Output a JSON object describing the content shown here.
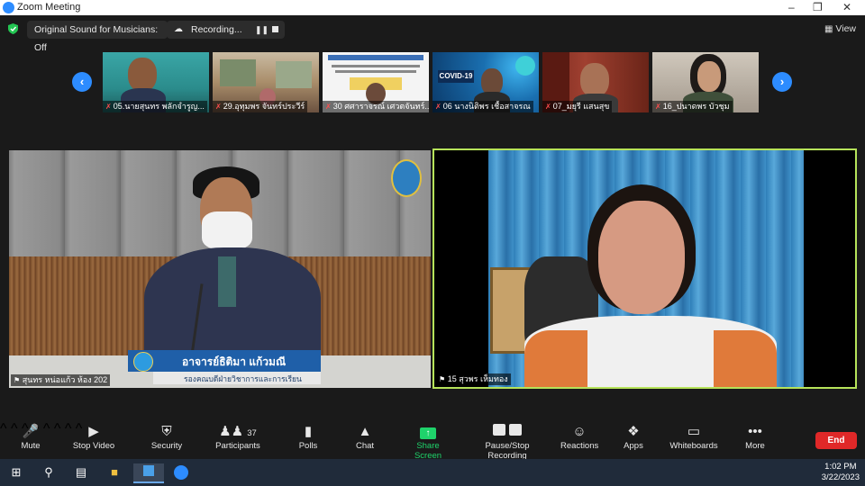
{
  "window": {
    "title": "Zoom Meeting"
  },
  "topbar": {
    "audio_label": "Original Sound for Musicians: Off",
    "recording_label": "Recording...",
    "view_label": "View"
  },
  "gallery": {
    "participants": [
      {
        "name": "05.นายสุนทร พลักจำรูญ..."
      },
      {
        "name": "29.อุทุมพร จันทร์ประวีร์"
      },
      {
        "name": "30 ศศาราจรณ์ เศวตจันทร์..."
      },
      {
        "name": "06 นางนิติพร เชื้อสาจรณ"
      },
      {
        "name": "07_มยุรี แสนสุข"
      },
      {
        "name": "16_ปนาดพร บัวชุม"
      }
    ]
  },
  "main_left": {
    "name": "สุนทร หน่อแก้ว ห้อง 202",
    "caption_name": "อาจารย์ธิติมา แก้วมณี",
    "caption_title": "รองคณบดีฝ่ายวิชาการและการเรียน"
  },
  "main_right": {
    "name": "15 สุวพร เห็มทอง"
  },
  "toolbar": {
    "mute": "Mute",
    "stop_video": "Stop Video",
    "security": "Security",
    "participants": "Participants",
    "participants_count": "37",
    "polls": "Polls",
    "chat": "Chat",
    "share_screen": "Share Screen",
    "recording": "Pause/Stop Recording",
    "reactions": "Reactions",
    "apps": "Apps",
    "whiteboards": "Whiteboards",
    "more": "More",
    "end": "End"
  },
  "taskbar": {
    "time": "1:02 PM",
    "date": "3/22/2023"
  },
  "colors": {
    "accent_blue": "#2d8cff",
    "share_green": "#1fd36b",
    "active_border": "#b6e35a",
    "end_red": "#e02828"
  }
}
